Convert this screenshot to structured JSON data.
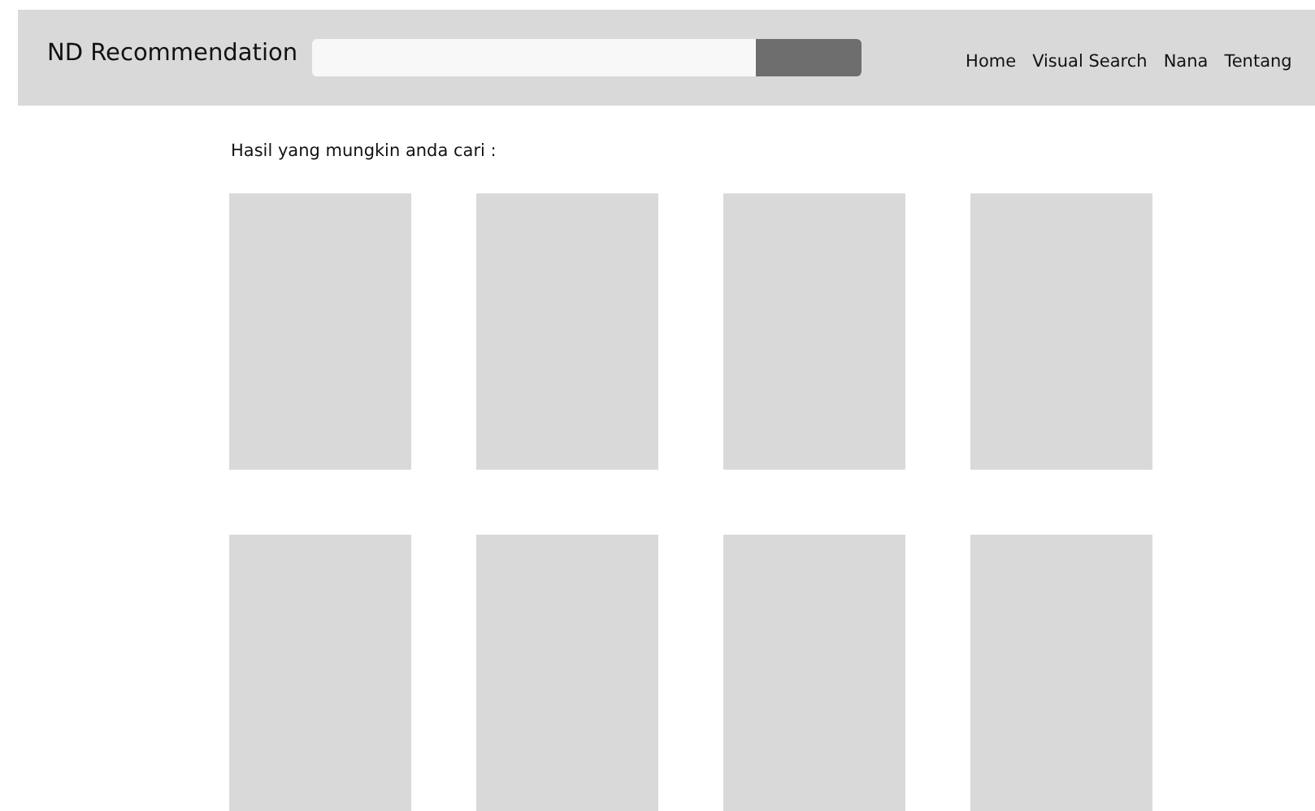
{
  "header": {
    "brand": "ND Recommendation",
    "nav": [
      {
        "label": "Home"
      },
      {
        "label": "Visual Search"
      },
      {
        "label": "Nana"
      },
      {
        "label": "Tentang"
      }
    ]
  },
  "results": {
    "heading": "Hasil yang mungkin anda cari :",
    "items": [
      {
        "kind": "placeholder"
      },
      {
        "kind": "placeholder"
      },
      {
        "kind": "placeholder"
      },
      {
        "kind": "placeholder"
      },
      {
        "kind": "placeholder"
      },
      {
        "kind": "placeholder"
      },
      {
        "kind": "placeholder"
      },
      {
        "kind": "placeholder"
      }
    ]
  }
}
